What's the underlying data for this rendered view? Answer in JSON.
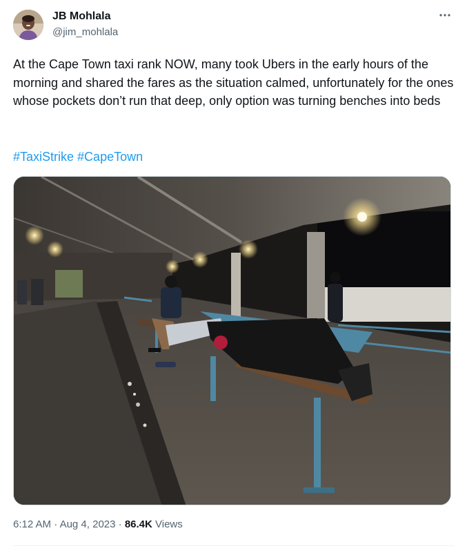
{
  "author": {
    "display_name": "JB Mohlala",
    "handle": "@jim_mohlala"
  },
  "tweet": {
    "text": "At the Cape Town taxi rank NOW, many took Ubers in the early hours of the morning and shared the fares as the situation calmed, unfortunately for the ones whose pockets don’t run that deep, only option was turning benches into beds",
    "hashtags": [
      "#TaxiStrike",
      "#CapeTown"
    ]
  },
  "meta": {
    "time": "6:12 AM",
    "separator": " · ",
    "date": "Aug 4, 2023",
    "views_count": "86.4K",
    "views_label": "Views"
  },
  "icons": {
    "more": "more-horizontal-icon"
  },
  "colors": {
    "link": "#1d9bf0",
    "secondary_text": "#536471",
    "primary_text": "#0f1419",
    "divider": "#eff3f4"
  }
}
